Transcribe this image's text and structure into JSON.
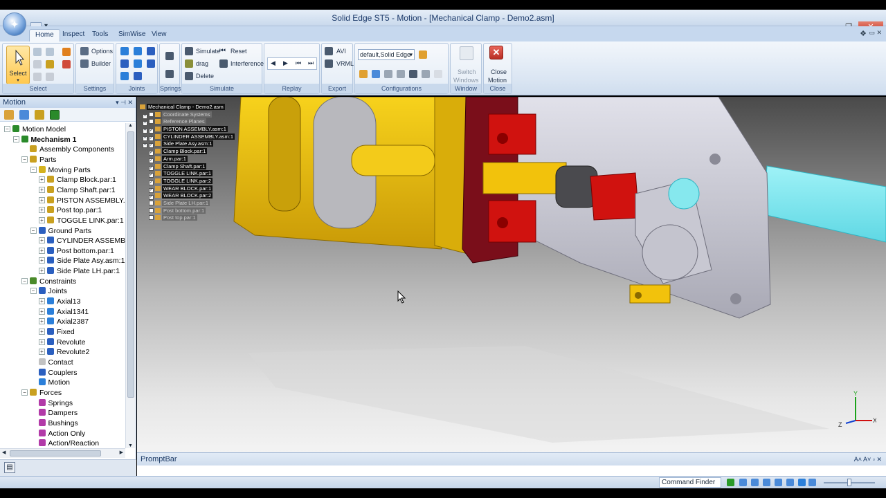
{
  "window": {
    "title": "Solid Edge ST5 - Motion - [Mechanical Clamp - Demo2.asm]",
    "controls": [
      "—",
      "❐",
      "✕"
    ]
  },
  "tabs": [
    {
      "label": "Home",
      "active": true
    },
    {
      "label": "Inspect"
    },
    {
      "label": "Tools"
    },
    {
      "label": "SimWise"
    },
    {
      "label": "View"
    }
  ],
  "ribbon": {
    "select": {
      "label": "Select",
      "group": "Select"
    },
    "settings": {
      "options": "Options",
      "builder": "Builder",
      "group": "Settings"
    },
    "joints": {
      "group": "Joints"
    },
    "springs": {
      "group": "Springs"
    },
    "simulate": {
      "simulate": "Simulate",
      "reset": "Reset",
      "drag": "drag",
      "interference": "Interference",
      "delete": "Delete",
      "group": "Simulate"
    },
    "replay": {
      "group": "Replay",
      "buttons": [
        "◀",
        "▶",
        "⏮",
        "⏭"
      ]
    },
    "export": {
      "avi": "AVI",
      "vrml": "VRML",
      "group": "Export"
    },
    "configurations": {
      "value": "default,Solid Edge",
      "group": "Configurations"
    },
    "window": {
      "switch": "Switch",
      "windows": "Windows",
      "group": "Window"
    },
    "close": {
      "close": "Close",
      "motion": "Motion",
      "group": "Close"
    }
  },
  "left_panel": {
    "title": "Motion",
    "tree": [
      {
        "label": "Motion Model",
        "level": 0,
        "exp": "−",
        "icon": "#2a8a2a",
        "bold": false
      },
      {
        "label": "Mechanism 1",
        "level": 1,
        "exp": "−",
        "icon": "#2a8a2a",
        "bold": true
      },
      {
        "label": "Assembly Components",
        "level": 2,
        "exp": "",
        "icon": "#c9a020"
      },
      {
        "label": "Parts",
        "level": 2,
        "exp": "−",
        "icon": "#c9a020"
      },
      {
        "label": "Moving Parts",
        "level": 3,
        "exp": "−",
        "icon": "#d4b21e"
      },
      {
        "label": "Clamp Block.par:1",
        "level": 4,
        "exp": "+",
        "icon": "#c9a020"
      },
      {
        "label": "Clamp Shaft.par:1",
        "level": 4,
        "exp": "+",
        "icon": "#c9a020"
      },
      {
        "label": "PISTON ASSEMBLY.asm",
        "level": 4,
        "exp": "+",
        "icon": "#c9a020"
      },
      {
        "label": "Post top.par:1",
        "level": 4,
        "exp": "+",
        "icon": "#c9a020"
      },
      {
        "label": "TOGGLE LINK.par:1",
        "level": 4,
        "exp": "+",
        "icon": "#c9a020"
      },
      {
        "label": "Ground Parts",
        "level": 3,
        "exp": "−",
        "icon": "#2b5fbf"
      },
      {
        "label": "CYLINDER ASSEMBLY.",
        "level": 4,
        "exp": "+",
        "icon": "#2b5fbf"
      },
      {
        "label": "Post bottom.par:1",
        "level": 4,
        "exp": "+",
        "icon": "#2b5fbf"
      },
      {
        "label": "Side Plate Asy.asm:1",
        "level": 4,
        "exp": "+",
        "icon": "#2b5fbf"
      },
      {
        "label": "Side Plate LH.par:1",
        "level": 4,
        "exp": "+",
        "icon": "#2b5fbf"
      },
      {
        "label": "Constraints",
        "level": 2,
        "exp": "−",
        "icon": "#4a8a2a"
      },
      {
        "label": "Joints",
        "level": 3,
        "exp": "−",
        "icon": "#2b5fbf"
      },
      {
        "label": "Axial13",
        "level": 4,
        "exp": "+",
        "icon": "#2b7fd9"
      },
      {
        "label": "Axial1341",
        "level": 4,
        "exp": "+",
        "icon": "#2b7fd9"
      },
      {
        "label": "Axial2387",
        "level": 4,
        "exp": "+",
        "icon": "#2b7fd9"
      },
      {
        "label": "Fixed",
        "level": 4,
        "exp": "+",
        "icon": "#2b5fbf"
      },
      {
        "label": "Revolute",
        "level": 4,
        "exp": "+",
        "icon": "#2b5fbf"
      },
      {
        "label": "Revolute2",
        "level": 4,
        "exp": "+",
        "icon": "#2b5fbf"
      },
      {
        "label": "Contact",
        "level": 3,
        "exp": "",
        "icon": "#c2c2c2"
      },
      {
        "label": "Couplers",
        "level": 3,
        "exp": "",
        "icon": "#2b5fbf"
      },
      {
        "label": "Motion",
        "level": 3,
        "exp": "",
        "icon": "#2b7fd9"
      },
      {
        "label": "Forces",
        "level": 2,
        "exp": "−",
        "icon": "#c9a020"
      },
      {
        "label": "Springs",
        "level": 3,
        "exp": "",
        "icon": "#b23aa8"
      },
      {
        "label": "Dampers",
        "level": 3,
        "exp": "",
        "icon": "#b23aa8"
      },
      {
        "label": "Bushings",
        "level": 3,
        "exp": "",
        "icon": "#b23aa8"
      },
      {
        "label": "Action Only",
        "level": 3,
        "exp": "",
        "icon": "#b23aa8"
      },
      {
        "label": "Action/Reaction",
        "level": 3,
        "exp": "",
        "icon": "#b23aa8"
      }
    ]
  },
  "pathfinder": {
    "root": "Mechanical Clamp - Demo2.asm",
    "items": [
      {
        "label": "Coordinate Systems",
        "checked": false,
        "exp": "+",
        "dim": true
      },
      {
        "label": "Reference Planes",
        "checked": false,
        "exp": "+",
        "dim": true
      },
      {
        "label": "PISTON ASSEMBLY.asm:1",
        "checked": true,
        "exp": "+",
        "dim": false
      },
      {
        "label": "CYLINDER ASSEMBLY.asm:1",
        "checked": true,
        "exp": "+",
        "dim": false
      },
      {
        "label": "Side Plate Asy.asm:1",
        "checked": true,
        "exp": "+",
        "dim": false
      },
      {
        "label": "Clamp Block.par:1",
        "checked": true,
        "exp": "",
        "dim": false
      },
      {
        "label": "Arm.par:1",
        "checked": true,
        "exp": "",
        "dim": false
      },
      {
        "label": "Clamp Shaft.par:1",
        "checked": true,
        "exp": "",
        "dim": false
      },
      {
        "label": "TOGGLE LINK.par:1",
        "checked": true,
        "exp": "",
        "dim": false
      },
      {
        "label": "TOGGLE LINK.par:2",
        "checked": true,
        "exp": "",
        "dim": false
      },
      {
        "label": "WEAR BLOCK.par:1",
        "checked": true,
        "exp": "",
        "dim": false
      },
      {
        "label": "WEAR BLOCK.par:2",
        "checked": true,
        "exp": "",
        "dim": false
      },
      {
        "label": "Side Plate LH.par:1",
        "checked": false,
        "exp": "",
        "dim": true
      },
      {
        "label": "Post bottom.par:1",
        "checked": false,
        "exp": "",
        "dim": true
      },
      {
        "label": "Post top.par:1",
        "checked": false,
        "exp": "",
        "dim": true
      }
    ]
  },
  "triad": {
    "x": "X",
    "y": "Y",
    "z": "Z"
  },
  "promptbar": {
    "title": "PromptBar",
    "controls": "A˄ A˅ ▫ ✕"
  },
  "statusbar": {
    "command_finder": "Command Finder"
  },
  "colors": {
    "yellow_part": "#f2c20c",
    "red_part": "#d0120f",
    "cyan_part": "#7be8f0",
    "gray_part": "#c8c8d2"
  }
}
